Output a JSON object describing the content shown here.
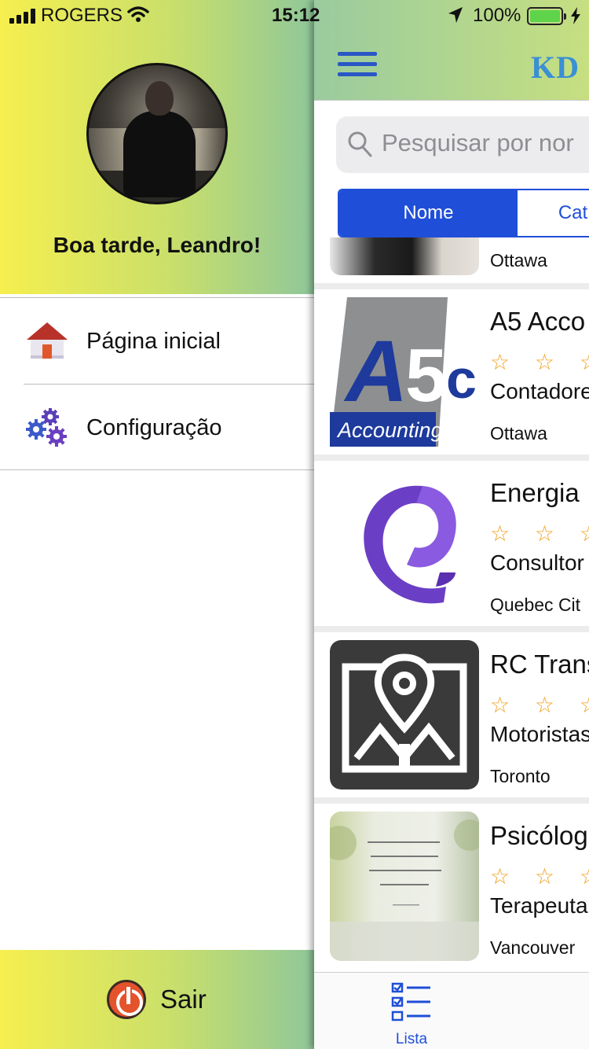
{
  "status_bar": {
    "carrier": "ROGERS",
    "time": "15:12",
    "battery_percent": "100%",
    "battery_level": 1.0
  },
  "drawer": {
    "greeting": "Boa tarde, Leandro!",
    "menu": [
      {
        "label": "Página inicial",
        "icon": "house-icon"
      },
      {
        "label": "Configuração",
        "icon": "gears-icon"
      }
    ],
    "logout_label": "Sair"
  },
  "navbar": {
    "brand": "KD",
    "menu_icon": "hamburger-icon"
  },
  "search": {
    "placeholder": "Pesquisar por nor"
  },
  "segment": {
    "options": [
      "Nome",
      "Cat"
    ],
    "selected": "Nome"
  },
  "listings": [
    {
      "title": "",
      "category": "",
      "city": "Ottawa",
      "stars": "",
      "partial": true
    },
    {
      "title": "A5 Acco",
      "stars": "☆ ☆ ☆",
      "category": "Contadore",
      "city": "Ottawa",
      "thumb_text": "Accounting"
    },
    {
      "title": "Energia",
      "stars": "☆ ☆ ☆ ☆",
      "category": "Consultor",
      "city": "Quebec Cit"
    },
    {
      "title": "RC Trans",
      "stars": "☆ ☆ ☆ ☆",
      "category": "Motoristas",
      "city": "Toronto"
    },
    {
      "title": "Psicólog",
      "stars": "☆ ☆ ☆ ☆",
      "category": "Terapeuta",
      "city": "Vancouver"
    }
  ],
  "tabbar": {
    "tabs": [
      {
        "label": "Lista",
        "active": true
      }
    ]
  },
  "colors": {
    "accent": "#1f4fd8",
    "star": "#f0a01e",
    "gradient_start": "#f6ef4f",
    "gradient_end": "#8fc79a"
  }
}
